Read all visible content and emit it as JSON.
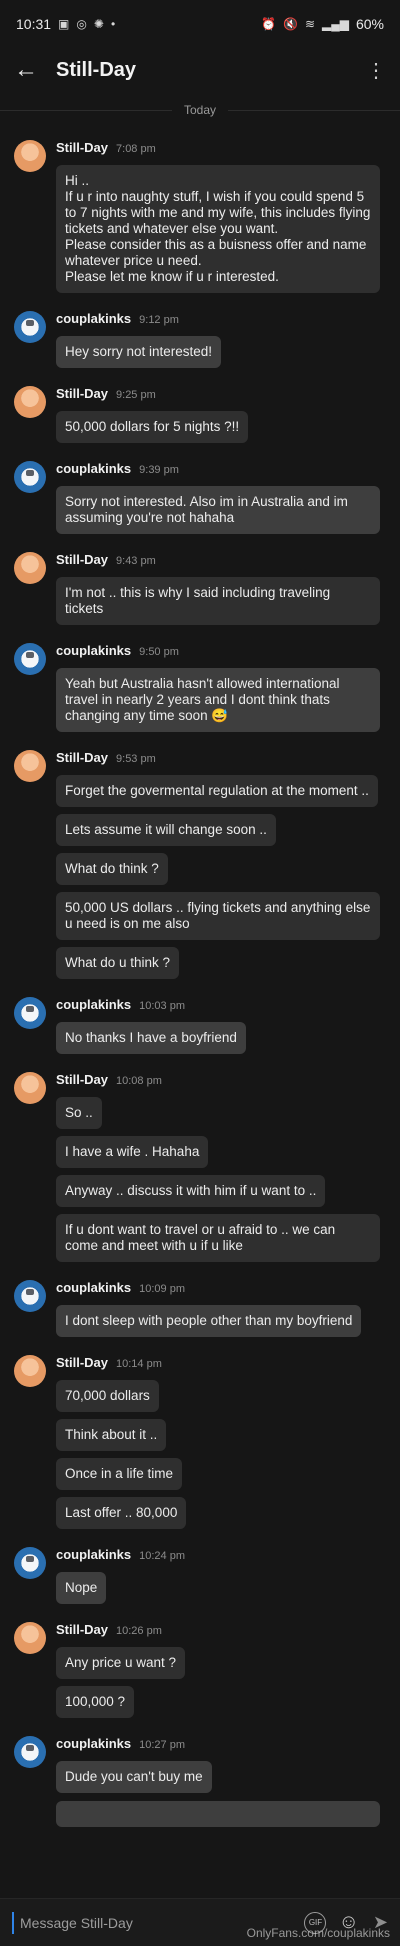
{
  "status": {
    "time": "10:31",
    "battery": "60%"
  },
  "header": {
    "title": "Still-Day"
  },
  "date_separator": "Today",
  "messages": [
    {
      "sender": "Still-Day",
      "time": "7:08 pm",
      "mine": false,
      "bubbles": [
        "Hi ..\nIf u r into naughty stuff, I wish if you could spend 5 to 7 nights with me and my wife, this includes flying tickets and whatever else you want.\nPlease consider this as a buisness offer and name whatever price u need.\nPlease let me know if u r interested."
      ]
    },
    {
      "sender": "couplakinks",
      "time": "9:12 pm",
      "mine": true,
      "bubbles": [
        "Hey sorry not interested!"
      ]
    },
    {
      "sender": "Still-Day",
      "time": "9:25 pm",
      "mine": false,
      "bubbles": [
        "50,000 dollars for 5 nights ?!!"
      ]
    },
    {
      "sender": "couplakinks",
      "time": "9:39 pm",
      "mine": true,
      "bubbles": [
        "Sorry not interested. Also im in Australia and im assuming you're not hahaha"
      ]
    },
    {
      "sender": "Still-Day",
      "time": "9:43 pm",
      "mine": false,
      "bubbles": [
        "I'm not .. this is why I said including traveling tickets"
      ]
    },
    {
      "sender": "couplakinks",
      "time": "9:50 pm",
      "mine": true,
      "bubbles": [
        "Yeah but Australia hasn't allowed international travel in nearly 2 years and I dont think thats changing any time soon 😅"
      ]
    },
    {
      "sender": "Still-Day",
      "time": "9:53 pm",
      "mine": false,
      "bubbles": [
        "Forget the govermental regulation at the moment ..",
        "Lets assume it will change soon ..",
        "What do think ?",
        "50,000 US dollars .. flying tickets and anything else u need is on me also",
        "What do u think ?"
      ]
    },
    {
      "sender": "couplakinks",
      "time": "10:03 pm",
      "mine": true,
      "bubbles": [
        "No thanks I have a boyfriend"
      ]
    },
    {
      "sender": "Still-Day",
      "time": "10:08 pm",
      "mine": false,
      "bubbles": [
        "So ..",
        "I have a wife . Hahaha",
        "Anyway .. discuss it with him if u want to ..",
        "If u dont want to travel or u afraid to .. we can come and meet with u if u like"
      ]
    },
    {
      "sender": "couplakinks",
      "time": "10:09 pm",
      "mine": true,
      "bubbles": [
        "I dont sleep with people other than my boyfriend"
      ]
    },
    {
      "sender": "Still-Day",
      "time": "10:14 pm",
      "mine": false,
      "bubbles": [
        "70,000 dollars",
        "Think about it ..",
        "Once in a life time",
        "Last offer .. 80,000"
      ]
    },
    {
      "sender": "couplakinks",
      "time": "10:24 pm",
      "mine": true,
      "bubbles": [
        "Nope"
      ]
    },
    {
      "sender": "Still-Day",
      "time": "10:26 pm",
      "mine": false,
      "bubbles": [
        "Any price u want ?",
        "100,000 ?"
      ]
    },
    {
      "sender": "couplakinks",
      "time": "10:27 pm",
      "mine": true,
      "bubbles": [
        "Dude you can't buy me"
      ]
    }
  ],
  "composer": {
    "placeholder": "Message Still-Day",
    "gif_label": "GIF"
  },
  "watermark": "OnlyFans.com/couplakinks",
  "icons": {
    "back": "arrow-left-icon",
    "more": "kebab-menu-icon",
    "gif": "gif-icon",
    "emoji": "emoji-icon",
    "send": "send-icon"
  }
}
